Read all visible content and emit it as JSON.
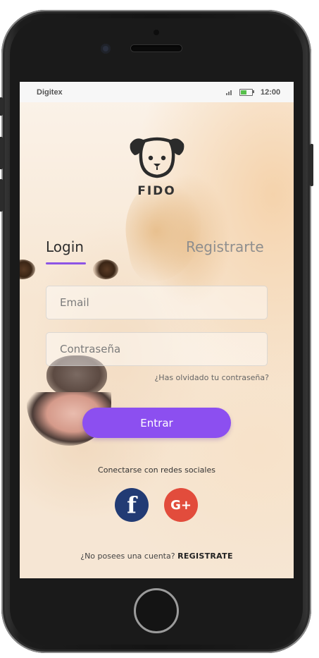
{
  "status_bar": {
    "carrier": "Digitex",
    "time": "12:00"
  },
  "app": {
    "name": "FIDO",
    "logo_icon": "dog-face-icon"
  },
  "tabs": [
    {
      "label": "Login",
      "active": true
    },
    {
      "label": "Registrarte",
      "active": false
    }
  ],
  "form": {
    "email_placeholder": "Email",
    "password_placeholder": "Contraseña",
    "forgot_password": "¿Has olvidado tu contraseña?",
    "submit_label": "Entrar"
  },
  "social": {
    "title": "Conectarse con redes sociales",
    "facebook": {
      "glyph": "f",
      "icon": "facebook-icon",
      "color": "#223b74"
    },
    "google_plus": {
      "glyph": "G+",
      "icon": "google-plus-icon",
      "color": "#e24c3c"
    }
  },
  "footer": {
    "prompt": "¿No posees una cuenta?",
    "link": "REGISTRATE"
  },
  "colors": {
    "accent": "#8c4ff0"
  }
}
